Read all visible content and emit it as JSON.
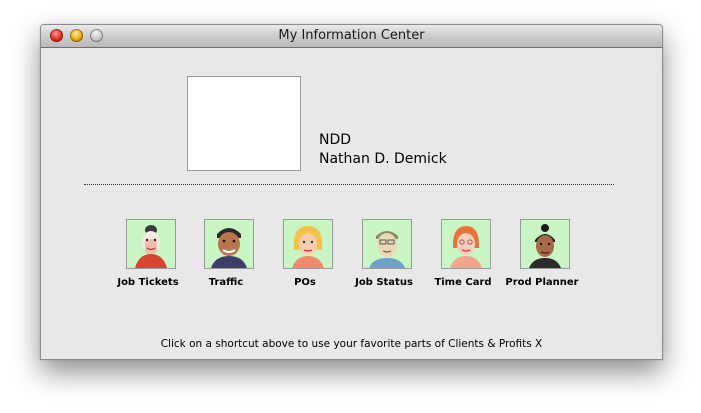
{
  "window": {
    "title": "My Information Center"
  },
  "user": {
    "initials": "NDD",
    "full_name": "Nathan D. Demick"
  },
  "shortcuts": [
    {
      "label": "Job Tickets",
      "icon": "job-tickets-avatar-icon"
    },
    {
      "label": "Traffic",
      "icon": "traffic-avatar-icon"
    },
    {
      "label": "POs",
      "icon": "pos-avatar-icon"
    },
    {
      "label": "Job Status",
      "icon": "job-status-avatar-icon"
    },
    {
      "label": "Time Card",
      "icon": "time-card-avatar-icon"
    },
    {
      "label": "Prod Planner",
      "icon": "prod-planner-avatar-icon"
    }
  ],
  "footer": {
    "hint": "Click on a shortcut above to use your favorite parts of Clients & Profits X"
  },
  "colors": {
    "window_bg": "#e8e8e8",
    "icon_bg": "#c9f5c4",
    "close": "#e0271c",
    "minimize": "#e8a50f",
    "zoom": "#c7c7c7"
  }
}
